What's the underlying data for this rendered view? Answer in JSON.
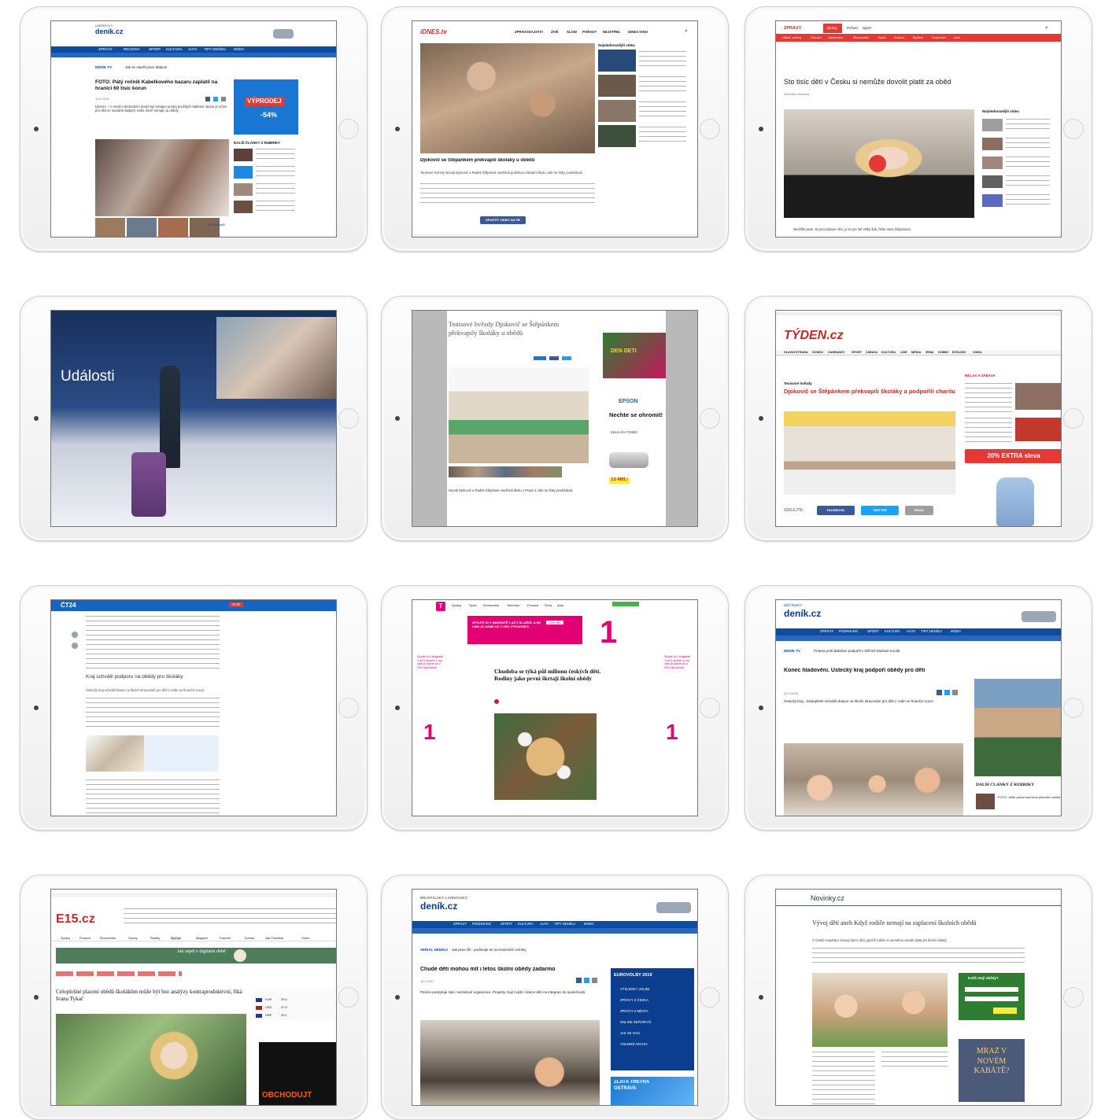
{
  "tablets": [
    {
      "brand": "deník.cz",
      "region": "LIBERECKÝ",
      "nav": [
        "ZPRÁVY",
        "REGIONY",
        "SPORT",
        "KULTURA",
        "AUTA",
        "TIPY DENÍKU",
        "MÓDA"
      ],
      "ticker_label": "DENÍK TV",
      "ticker": "Jak se stavěl první Mattoni",
      "headline": "FOTO: Pátý ročník Kabelkového bazaru zaplatil na hranici 60 tisíc korun",
      "date": "11.6.2018",
      "lead": "Liberec – V novém obchodním domě byl zahájen prodej použitých kabelek. Bazar je určen pro děti ze sociálně slabých rodin, které nemají na obědy.",
      "ad_title": "VÝPRODEJ",
      "ad_pct": "-54%",
      "related_title": "DALŠÍ ČLÁNKY Z RUBRIKY",
      "gallery_count": "40 fotografií"
    },
    {
      "brand": "iDNES.tv",
      "nav": [
        "ZPRAVODAJSTVÍ",
        "ŽIVĚ",
        "SLOW",
        "POŘADY",
        "NEJSTŘEL",
        "iDNES KINO"
      ],
      "sidebar_title": "Nejsledovanější videa",
      "headline": "Djokovič se Štěpánkem překvapili školáky u obědů",
      "lead": "Tenisové hvězdy Novak Djokovič a Radek Štěpánek navštívili pražskou základní školu, kde se žáky poobědvali.",
      "share_label": "SPUSTIT VIDEO NA FB"
    },
    {
      "brand": "ZPRÁVY",
      "nav": [
        "Zprávy",
        "Počasí",
        "Sport"
      ],
      "subnav": [
        "Hlavní zprávy",
        "Domácí",
        "Zahraniční",
        "Ekonomika",
        "Sport",
        "Kultura",
        "Bydlení",
        "Cestování",
        "Auto"
      ],
      "headline": "Sto tisíc dětí v Česku si nemůže dovolit platit za oběd",
      "author": "Veronika Jandová",
      "sidebar_title": "Nejsledovanější videa",
      "caption": "Nevěřila jsem, že jsou takové věci, je to pro mě velký šok, řekla Jana Štěpánová."
    },
    {
      "title": "Události"
    },
    {
      "headline": "Tenisové hvězdy Djokovič se Štěpánkem překvapily školáky u obědů",
      "ad_brand": "EPSON",
      "ad_text": "Nechte se ohromit!",
      "ad_model": "Epson EH-TW650",
      "ad_price": "13 490,-",
      "ad_top": "DEN DĚTÍ",
      "lead": "Novak Djokovič a Radek Štěpánek navštívili školu v Praze 4, kde se žáky poobědvali."
    },
    {
      "brand": "TÝDEN.cz",
      "nav": [
        "HLAVNÍ STRANA",
        "DOMOV",
        "ZAHRANIČÍ",
        "SPORT",
        "ZÁBAVA",
        "KULTURA",
        "LIDÉ",
        "MÉDIA",
        "ŽENA",
        "HOBBY",
        "BYDLENÍ",
        "VIDEA"
      ],
      "kicker": "Tenisové hvězdy",
      "headline": "Djokovič se Štěpánkem překvapili školáky a podpořili charitu",
      "sidebar_title": "RELAX A ZÁBAVA",
      "ad_text": "20% EXTRA sleva",
      "share_label": "SDÍLEJTE:",
      "share_buttons": [
        "FACEBOOK",
        "TWITTER",
        "EMAIL"
      ]
    },
    {
      "brand": "ČT24",
      "headline": "Kraj schválil podporu na obědy pro školáky",
      "body": "Ústecký kraj schválil dotaci na školní stravování pro děti z rodin ve finanční nouzi.",
      "live_label": "ŽIVĚ"
    },
    {
      "brand": "T",
      "nav": [
        "Zprávy",
        "Sport",
        "Ekonomika",
        "Technika",
        "Finance",
        "Žena",
        "Auto"
      ],
      "promo": "SPOJTE SI V MAGENTĚ 1 AŽ 5 SLUŽEB, A MY VÁM JE DÁME AŽ O 25% VÝHODNĚJI.",
      "promo_cta": "Více zde",
      "headline": "Chudoba se týká půl milionu českých dětí. Rodiny jako první škrtají školní obědy",
      "side_text": "Spojte si v Magentě 1 až 5 služeb a my vám je dáme až o 25% výhodněji."
    },
    {
      "region": "DĚČÍNSKÝ",
      "brand": "deník.cz",
      "nav": [
        "ZPRÁVY",
        "PODNIKÁNÍ",
        "SPORT",
        "KULTURA",
        "AUTA",
        "TIPY DENÍKU",
        "MÓDA"
      ],
      "ticker_label": "DENÍK TV",
      "ticker": "Protest proti Babišovi podpořil v Děčíně Michael Kocáb",
      "headline": "Konec hladovění. Ústecký kraj podpoří obědy pro děti",
      "date": "18.3.2018",
      "lead": "Ústecký kraj - Zastupitelé schválili dotace na školní stravování pro děti z rodin ve finanční nouzi.",
      "related_title": "DALŠÍ ČLÁNKY Z RUBRIKY",
      "related_item": "FOTO: Větší pozornost letos přivedla i světla"
    },
    {
      "brand": "E15.cz",
      "nav": [
        "Zprávy",
        "Finance",
        "Ekonomika",
        "Sporty",
        "Reality",
        "Byznys",
        "Magazín",
        "Partneři",
        "Events",
        "Jak Podnikat",
        "Video"
      ],
      "banner": "Jak uspět v digitální době",
      "headline": "Celoplošné placení obědů školákům může být bez analýzy kontraproduktivní, říká Ivana Tykač",
      "ad_text": "OBCHODUJT",
      "rates": [
        {
          "code": "EUR",
          "value": "25,6"
        },
        {
          "code": "USD",
          "value": "22,9"
        },
        {
          "code": "GBP",
          "value": "29,1"
        }
      ]
    },
    {
      "region": "BRUNTÁLSKÝ A KRNOVSKÝ",
      "brand": "deník.cz",
      "nav": [
        "ZPRÁVY",
        "PODNIKÁNÍ",
        "SPORT",
        "KULTURA",
        "AUTA",
        "TIPY DENÍKU",
        "MÓDA"
      ],
      "ticker_label": "SERIÁL DENÍKU",
      "ticker": "Jak jsme žili - podívejte se na historické snímky",
      "headline": "Chudé děti mohou mít i letos školní obědy zadarmo",
      "date": "18.9.2017",
      "lead": "Peníze poskytuje stát i neziskové organizace. Projekty mají zvýšit i šance dětí na integraci do společnosti.",
      "side_title": "EUROVOLBY 2019",
      "side_items": [
        "VÝSLEDKY VOLEB",
        "ZPRÁVY Z ČESKA",
        "ZPRÁVY Z MĚSTA",
        "ONLINE REPORTÁŽ",
        "JAK SE VOLÍ",
        "VOLEBNÍ ARCHIV"
      ],
      "ad_text": "ZLATÁ TRETRA OSTRAVA"
    },
    {
      "brand": "Novinky.cz",
      "headline": "Vývoj dětí aneb Když rodiče nemají na zaplacení školních obědů",
      "lead": "V České republice nemají tisíce dětí, jejichž rodiče si nemohou dovolit platit jim školní obědy.",
      "widget_title": "Kolik stojí obědy?",
      "ad_text": "MRAŽ V NOVÉM KABÁTĚ?"
    }
  ]
}
